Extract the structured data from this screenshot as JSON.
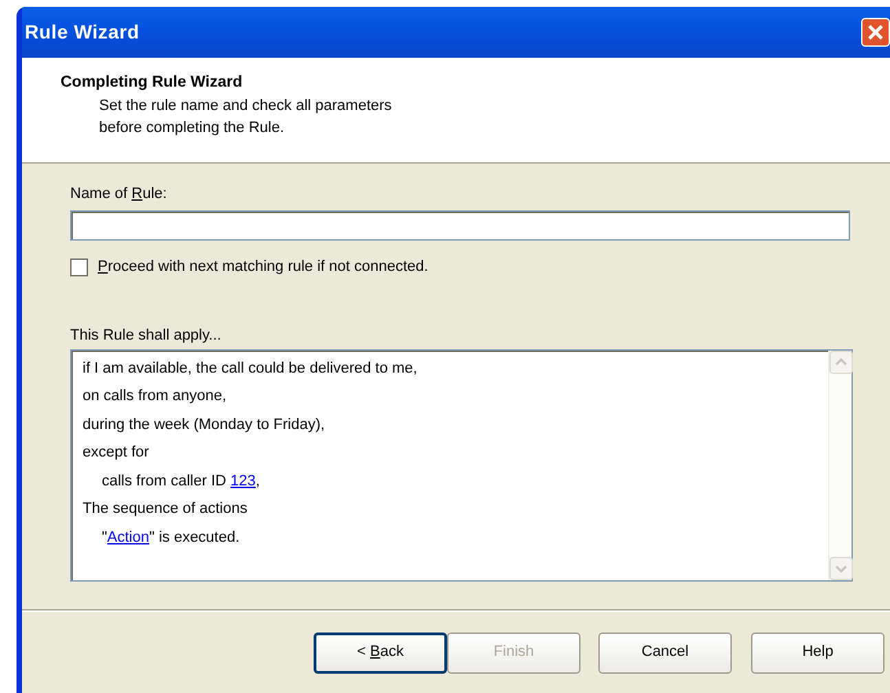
{
  "window": {
    "title": "Rule Wizard"
  },
  "header": {
    "title": "Completing Rule Wizard",
    "subtitle_lines": [
      "Set the rule name and check all parameters",
      "before completing the Rule."
    ]
  },
  "name_field": {
    "label": {
      "before": "Name of ",
      "key": "R",
      "after": "ule:"
    }
  },
  "proceed_checkbox": {
    "label": {
      "key": "P",
      "after": "roceed with next matching rule if not connected."
    },
    "checked": false
  },
  "rule_summary": {
    "label": "This Rule shall apply...",
    "lines": [
      {
        "indented": false,
        "parts": [
          {
            "kind": "text",
            "text": "if I am available, the call could be delivered to me,"
          }
        ]
      },
      {
        "indented": false,
        "parts": [
          {
            "kind": "text",
            "text": "on calls from anyone,"
          }
        ]
      },
      {
        "indented": false,
        "parts": [
          {
            "kind": "text",
            "text": "during the week (Monday to Friday),"
          }
        ]
      },
      {
        "indented": false,
        "parts": [
          {
            "kind": "text",
            "text": "except for"
          }
        ]
      },
      {
        "indented": true,
        "parts": [
          {
            "kind": "text",
            "text": "calls from caller ID "
          },
          {
            "kind": "link",
            "text": "123"
          },
          {
            "kind": "text",
            "text": ","
          }
        ]
      },
      {
        "indented": false,
        "parts": [
          {
            "kind": "text",
            "text": "The sequence of actions"
          }
        ]
      },
      {
        "indented": true,
        "parts": [
          {
            "kind": "text",
            "text": "\""
          },
          {
            "kind": "link",
            "text": "Action"
          },
          {
            "kind": "text",
            "text": "\" is executed."
          }
        ]
      }
    ]
  },
  "buttons": [
    {
      "label": {
        "before": "< ",
        "key": "B",
        "after": "ack"
      },
      "disabled": false,
      "default": true
    },
    {
      "label": {
        "before": "Finish"
      },
      "disabled": true,
      "default": false
    },
    {
      "label": {
        "before": "Cancel"
      },
      "disabled": false,
      "default": false
    },
    {
      "label": {
        "before": "Help"
      },
      "disabled": false,
      "default": false
    }
  ]
}
